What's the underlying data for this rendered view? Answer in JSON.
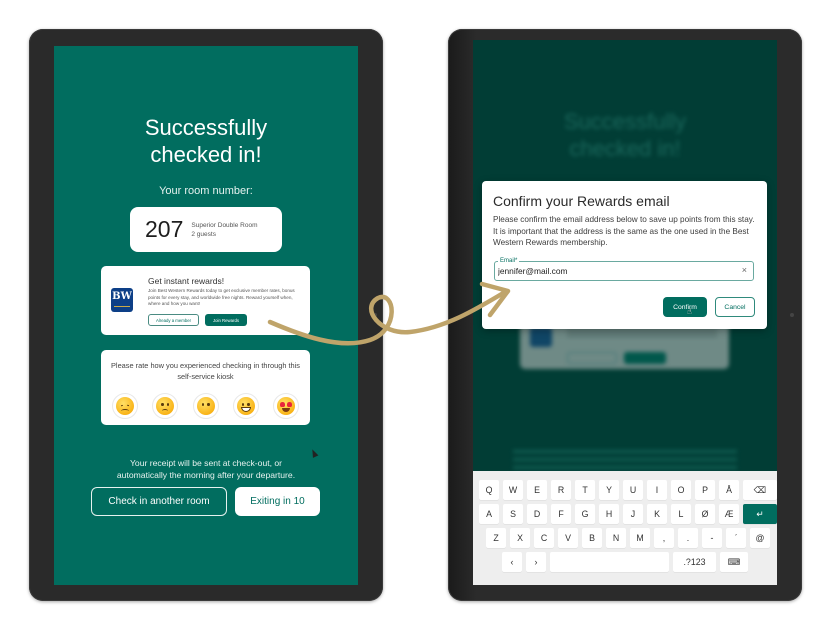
{
  "left_screen": {
    "title_line1": "Successfully",
    "title_line2": "checked in!",
    "room_label": "Your room number:",
    "room": {
      "number": "207",
      "type": "Superior Double Room",
      "guests": "2 guests"
    },
    "rewards": {
      "logo_text": "BW",
      "title": "Get instant rewards!",
      "body": "Join Best Western Rewards today to get exclusive member rates, bonus points for every stay, and worldwide free nights. Reward yourself when, where and how you want!",
      "already_member_label": "Already a member",
      "join_label": "Join Rewards"
    },
    "rating": {
      "prompt": "Please rate how you experienced checking in through this self-service kiosk",
      "options": [
        {
          "icon": "disappointed-face-icon",
          "label": "Very dissatisfied"
        },
        {
          "icon": "slightly-frowning-face-icon",
          "label": "Dissatisfied"
        },
        {
          "icon": "neutral-face-icon",
          "label": "Neutral"
        },
        {
          "icon": "grinning-face-icon",
          "label": "Satisfied"
        },
        {
          "icon": "heart-eyes-face-icon",
          "label": "Very satisfied"
        }
      ]
    },
    "receipt_line1": "Your receipt will be sent at check-out, or",
    "receipt_line2": "automatically the morning after your departure.",
    "check_in_another_label": "Check in another room",
    "exiting_label": "Exiting in 10"
  },
  "right_screen": {
    "background_title_line1": "Successfully",
    "background_title_line2": "checked in!",
    "dialog": {
      "title": "Confirm your Rewards email",
      "body": "Please confirm the email address below to save up points from this stay. It is important that the address is the same as the one used in the Best Western Rewards membership.",
      "email_label": "Email*",
      "email_value": "jennifer@mail.com",
      "clear_icon": "×",
      "confirm_label": "Confirm",
      "cancel_label": "Cancel"
    },
    "keyboard": {
      "row1": [
        "Q",
        "W",
        "E",
        "R",
        "T",
        "Y",
        "U",
        "I",
        "O",
        "P",
        "Å"
      ],
      "row2": [
        "A",
        "S",
        "D",
        "F",
        "G",
        "H",
        "J",
        "K",
        "L",
        "Ø",
        "Æ"
      ],
      "row3": [
        "Z",
        "X",
        "C",
        "V",
        "B",
        "N",
        "M",
        ",",
        ".",
        "-",
        "ˊ",
        "@"
      ],
      "backspace": "⌫",
      "enter": "↵",
      "left_arrow": "‹",
      "right_arrow": "›",
      "symbols": ".?123",
      "hide_keyboard": "⌨"
    }
  },
  "colors": {
    "brand_teal": "#016d5f",
    "dimmed_teal": "#013d35",
    "bezel": "#2a2a2a",
    "arrow_gold": "#bfa46a",
    "bw_blue": "#0d3f87"
  }
}
